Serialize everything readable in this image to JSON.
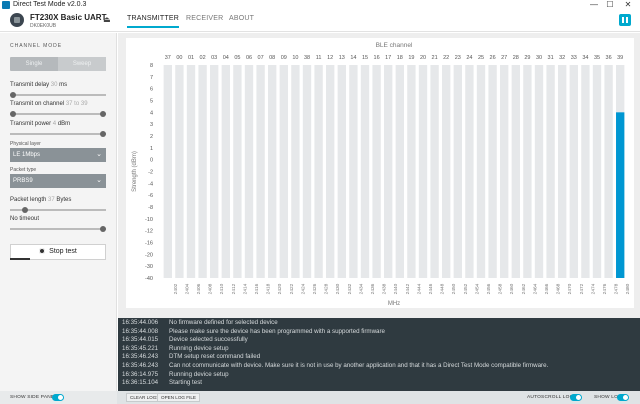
{
  "window": {
    "title": "Direct Test Mode v2.0.3",
    "minimize": "—",
    "maximize": "☐",
    "close": "✕"
  },
  "device": {
    "name": "FT230X Basic UART",
    "serial": "DK0EK0UB"
  },
  "nav": {
    "tabs": [
      "TRANSMITTER",
      "RECEIVER",
      "ABOUT"
    ],
    "active": "TRANSMITTER"
  },
  "sidebar": {
    "channel_mode_title": "CHANNEL MODE",
    "mode_options": [
      "Single",
      "Sweep"
    ],
    "selected_mode": "Sweep",
    "tx_delay_label": "Transmit delay",
    "tx_delay_value": "30",
    "tx_delay_unit": "ms",
    "tx_channel_label": "Transmit on channel",
    "tx_channel_from": "37",
    "tx_channel_to_word": "to",
    "tx_channel_to": "39",
    "tx_power_label": "Transmit power",
    "tx_power_value": "4",
    "tx_power_unit": "dBm",
    "phy_label": "Physical layer",
    "phy_value": "LE 1Mbps",
    "packet_type_label": "Packet type",
    "packet_type_value": "PRBS9",
    "packet_length_label": "Packet length",
    "packet_length_value": "37",
    "packet_length_unit": "Bytes",
    "timeout_label": "No timeout",
    "stop_button": "Stop test"
  },
  "chart_data": {
    "type": "bar",
    "title": "BLE channel",
    "xlabel": "MHz",
    "ylabel": "Strength (dBm)",
    "ylim": [
      -40,
      8
    ],
    "yticks": [
      8,
      7,
      6,
      5,
      4,
      3,
      2,
      1,
      0,
      -2,
      -4,
      -6,
      -8,
      -10,
      -12,
      -16,
      -20,
      -30,
      -40
    ],
    "channels": [
      "37",
      "00",
      "01",
      "02",
      "03",
      "04",
      "05",
      "06",
      "07",
      "08",
      "09",
      "10",
      "38",
      "11",
      "12",
      "13",
      "14",
      "15",
      "16",
      "17",
      "18",
      "19",
      "20",
      "21",
      "22",
      "23",
      "24",
      "25",
      "26",
      "27",
      "28",
      "29",
      "30",
      "31",
      "32",
      "33",
      "34",
      "35",
      "36",
      "39"
    ],
    "frequencies": [
      "2402",
      "2404",
      "2406",
      "2408",
      "2410",
      "2412",
      "2414",
      "2416",
      "2418",
      "2420",
      "2422",
      "2424",
      "2426",
      "2428",
      "2430",
      "2432",
      "2434",
      "2436",
      "2438",
      "2440",
      "2442",
      "2444",
      "2446",
      "2448",
      "2450",
      "2452",
      "2454",
      "2456",
      "2458",
      "2460",
      "2462",
      "2464",
      "2466",
      "2468",
      "2470",
      "2472",
      "2474",
      "2476",
      "2478",
      "2480"
    ],
    "values": [
      -40,
      -40,
      -40,
      -40,
      -40,
      -40,
      -40,
      -40,
      -40,
      -40,
      -40,
      -40,
      -40,
      -40,
      -40,
      -40,
      -40,
      -40,
      -40,
      -40,
      -40,
      -40,
      -40,
      -40,
      -40,
      -40,
      -40,
      -40,
      -40,
      -40,
      -40,
      -40,
      -40,
      -40,
      -40,
      -40,
      -40,
      -40,
      -40,
      4
    ],
    "colors": {
      "background_bar": "#e6e8ea",
      "active_bar": "#0097d2"
    }
  },
  "log": [
    {
      "time": "16:35:44.006",
      "msg": "No firmware defined for selected device"
    },
    {
      "time": "16:35:44.008",
      "msg": "Please make sure the device has been programmed with a supported firmware"
    },
    {
      "time": "16:35:44.015",
      "msg": "Device selected successfully"
    },
    {
      "time": "16:35:45.221",
      "msg": "Running device setup"
    },
    {
      "time": "16:35:46.243",
      "msg": "DTM setup reset command failed"
    },
    {
      "time": "16:35:46.243",
      "msg": "Can not communicate with device. Make sure it is not in use by another application and that it has a Direct Test Mode compatible firmware."
    },
    {
      "time": "16:36:14.975",
      "msg": "Running device setup"
    },
    {
      "time": "16:36:15.104",
      "msg": "Starting test"
    }
  ],
  "footer": {
    "show_side_panel": "SHOW SIDE PANEL",
    "clear_logs": "CLEAR LOGS",
    "open_log_file": "OPEN LOG FILE",
    "autoscroll_logs": "AUTOSCROLL LOGS",
    "show_log": "SHOW LOG"
  },
  "colors": {
    "accent": "#00a9ce",
    "log_bg": "#2f3a40"
  }
}
